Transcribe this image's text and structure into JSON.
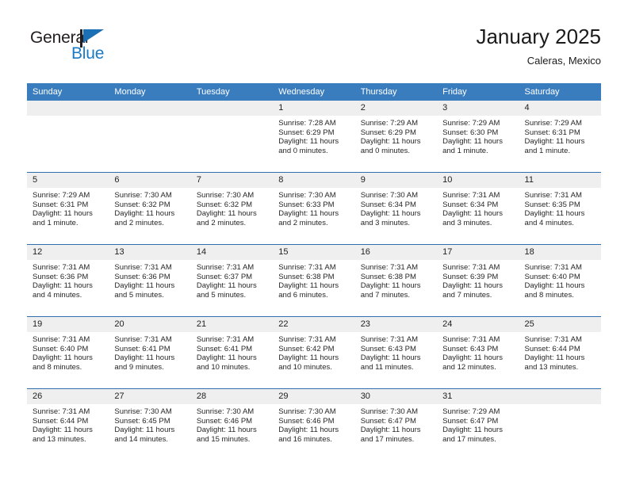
{
  "brand": {
    "name_part1": "General",
    "name_part2": "Blue",
    "logo_icon": "flag-triangle-icon",
    "accent_color": "#1a7ac4"
  },
  "header": {
    "month_title": "January 2025",
    "location": "Caleras, Mexico"
  },
  "calendar": {
    "header_bg": "#3a7dbf",
    "weekday_headers": [
      "Sunday",
      "Monday",
      "Tuesday",
      "Wednesday",
      "Thursday",
      "Friday",
      "Saturday"
    ],
    "weeks": [
      [
        {
          "day": "",
          "sunrise": "",
          "sunset": "",
          "daylight_line1": "",
          "daylight_line2": ""
        },
        {
          "day": "",
          "sunrise": "",
          "sunset": "",
          "daylight_line1": "",
          "daylight_line2": ""
        },
        {
          "day": "",
          "sunrise": "",
          "sunset": "",
          "daylight_line1": "",
          "daylight_line2": ""
        },
        {
          "day": "1",
          "sunrise": "Sunrise: 7:28 AM",
          "sunset": "Sunset: 6:29 PM",
          "daylight_line1": "Daylight: 11 hours",
          "daylight_line2": "and 0 minutes."
        },
        {
          "day": "2",
          "sunrise": "Sunrise: 7:29 AM",
          "sunset": "Sunset: 6:29 PM",
          "daylight_line1": "Daylight: 11 hours",
          "daylight_line2": "and 0 minutes."
        },
        {
          "day": "3",
          "sunrise": "Sunrise: 7:29 AM",
          "sunset": "Sunset: 6:30 PM",
          "daylight_line1": "Daylight: 11 hours",
          "daylight_line2": "and 1 minute."
        },
        {
          "day": "4",
          "sunrise": "Sunrise: 7:29 AM",
          "sunset": "Sunset: 6:31 PM",
          "daylight_line1": "Daylight: 11 hours",
          "daylight_line2": "and 1 minute."
        }
      ],
      [
        {
          "day": "5",
          "sunrise": "Sunrise: 7:29 AM",
          "sunset": "Sunset: 6:31 PM",
          "daylight_line1": "Daylight: 11 hours",
          "daylight_line2": "and 1 minute."
        },
        {
          "day": "6",
          "sunrise": "Sunrise: 7:30 AM",
          "sunset": "Sunset: 6:32 PM",
          "daylight_line1": "Daylight: 11 hours",
          "daylight_line2": "and 2 minutes."
        },
        {
          "day": "7",
          "sunrise": "Sunrise: 7:30 AM",
          "sunset": "Sunset: 6:32 PM",
          "daylight_line1": "Daylight: 11 hours",
          "daylight_line2": "and 2 minutes."
        },
        {
          "day": "8",
          "sunrise": "Sunrise: 7:30 AM",
          "sunset": "Sunset: 6:33 PM",
          "daylight_line1": "Daylight: 11 hours",
          "daylight_line2": "and 2 minutes."
        },
        {
          "day": "9",
          "sunrise": "Sunrise: 7:30 AM",
          "sunset": "Sunset: 6:34 PM",
          "daylight_line1": "Daylight: 11 hours",
          "daylight_line2": "and 3 minutes."
        },
        {
          "day": "10",
          "sunrise": "Sunrise: 7:31 AM",
          "sunset": "Sunset: 6:34 PM",
          "daylight_line1": "Daylight: 11 hours",
          "daylight_line2": "and 3 minutes."
        },
        {
          "day": "11",
          "sunrise": "Sunrise: 7:31 AM",
          "sunset": "Sunset: 6:35 PM",
          "daylight_line1": "Daylight: 11 hours",
          "daylight_line2": "and 4 minutes."
        }
      ],
      [
        {
          "day": "12",
          "sunrise": "Sunrise: 7:31 AM",
          "sunset": "Sunset: 6:36 PM",
          "daylight_line1": "Daylight: 11 hours",
          "daylight_line2": "and 4 minutes."
        },
        {
          "day": "13",
          "sunrise": "Sunrise: 7:31 AM",
          "sunset": "Sunset: 6:36 PM",
          "daylight_line1": "Daylight: 11 hours",
          "daylight_line2": "and 5 minutes."
        },
        {
          "day": "14",
          "sunrise": "Sunrise: 7:31 AM",
          "sunset": "Sunset: 6:37 PM",
          "daylight_line1": "Daylight: 11 hours",
          "daylight_line2": "and 5 minutes."
        },
        {
          "day": "15",
          "sunrise": "Sunrise: 7:31 AM",
          "sunset": "Sunset: 6:38 PM",
          "daylight_line1": "Daylight: 11 hours",
          "daylight_line2": "and 6 minutes."
        },
        {
          "day": "16",
          "sunrise": "Sunrise: 7:31 AM",
          "sunset": "Sunset: 6:38 PM",
          "daylight_line1": "Daylight: 11 hours",
          "daylight_line2": "and 7 minutes."
        },
        {
          "day": "17",
          "sunrise": "Sunrise: 7:31 AM",
          "sunset": "Sunset: 6:39 PM",
          "daylight_line1": "Daylight: 11 hours",
          "daylight_line2": "and 7 minutes."
        },
        {
          "day": "18",
          "sunrise": "Sunrise: 7:31 AM",
          "sunset": "Sunset: 6:40 PM",
          "daylight_line1": "Daylight: 11 hours",
          "daylight_line2": "and 8 minutes."
        }
      ],
      [
        {
          "day": "19",
          "sunrise": "Sunrise: 7:31 AM",
          "sunset": "Sunset: 6:40 PM",
          "daylight_line1": "Daylight: 11 hours",
          "daylight_line2": "and 8 minutes."
        },
        {
          "day": "20",
          "sunrise": "Sunrise: 7:31 AM",
          "sunset": "Sunset: 6:41 PM",
          "daylight_line1": "Daylight: 11 hours",
          "daylight_line2": "and 9 minutes."
        },
        {
          "day": "21",
          "sunrise": "Sunrise: 7:31 AM",
          "sunset": "Sunset: 6:41 PM",
          "daylight_line1": "Daylight: 11 hours",
          "daylight_line2": "and 10 minutes."
        },
        {
          "day": "22",
          "sunrise": "Sunrise: 7:31 AM",
          "sunset": "Sunset: 6:42 PM",
          "daylight_line1": "Daylight: 11 hours",
          "daylight_line2": "and 10 minutes."
        },
        {
          "day": "23",
          "sunrise": "Sunrise: 7:31 AM",
          "sunset": "Sunset: 6:43 PM",
          "daylight_line1": "Daylight: 11 hours",
          "daylight_line2": "and 11 minutes."
        },
        {
          "day": "24",
          "sunrise": "Sunrise: 7:31 AM",
          "sunset": "Sunset: 6:43 PM",
          "daylight_line1": "Daylight: 11 hours",
          "daylight_line2": "and 12 minutes."
        },
        {
          "day": "25",
          "sunrise": "Sunrise: 7:31 AM",
          "sunset": "Sunset: 6:44 PM",
          "daylight_line1": "Daylight: 11 hours",
          "daylight_line2": "and 13 minutes."
        }
      ],
      [
        {
          "day": "26",
          "sunrise": "Sunrise: 7:31 AM",
          "sunset": "Sunset: 6:44 PM",
          "daylight_line1": "Daylight: 11 hours",
          "daylight_line2": "and 13 minutes."
        },
        {
          "day": "27",
          "sunrise": "Sunrise: 7:30 AM",
          "sunset": "Sunset: 6:45 PM",
          "daylight_line1": "Daylight: 11 hours",
          "daylight_line2": "and 14 minutes."
        },
        {
          "day": "28",
          "sunrise": "Sunrise: 7:30 AM",
          "sunset": "Sunset: 6:46 PM",
          "daylight_line1": "Daylight: 11 hours",
          "daylight_line2": "and 15 minutes."
        },
        {
          "day": "29",
          "sunrise": "Sunrise: 7:30 AM",
          "sunset": "Sunset: 6:46 PM",
          "daylight_line1": "Daylight: 11 hours",
          "daylight_line2": "and 16 minutes."
        },
        {
          "day": "30",
          "sunrise": "Sunrise: 7:30 AM",
          "sunset": "Sunset: 6:47 PM",
          "daylight_line1": "Daylight: 11 hours",
          "daylight_line2": "and 17 minutes."
        },
        {
          "day": "31",
          "sunrise": "Sunrise: 7:29 AM",
          "sunset": "Sunset: 6:47 PM",
          "daylight_line1": "Daylight: 11 hours",
          "daylight_line2": "and 17 minutes."
        },
        {
          "day": "",
          "sunrise": "",
          "sunset": "",
          "daylight_line1": "",
          "daylight_line2": ""
        }
      ]
    ]
  }
}
